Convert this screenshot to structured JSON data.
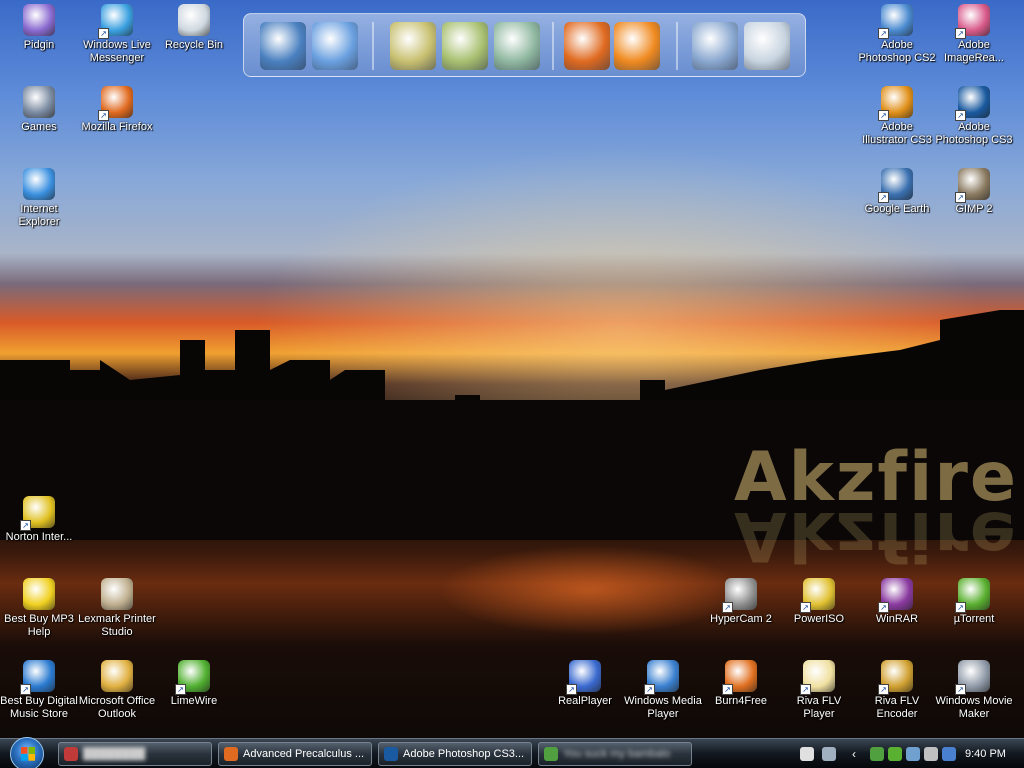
{
  "desktop": {
    "watermark": "Akzfire",
    "icons": [
      {
        "label": "Pidgin",
        "icon": "pidgin-icon",
        "color": "#8a6ad0"
      },
      {
        "label": "Windows Live Messenger",
        "icon": "messenger-icon",
        "color": "#3aa0e0"
      },
      {
        "label": "Recycle Bin",
        "icon": "recycle-bin-icon",
        "color": "#cfd8e0"
      },
      {
        "label": "Games",
        "icon": "games-icon",
        "color": "#7a8aa0"
      },
      {
        "label": "Mozilla Firefox",
        "icon": "firefox-icon",
        "color": "#e06a20"
      },
      {
        "label": "Internet Explorer",
        "icon": "internet-explorer-icon",
        "color": "#3a90e0"
      },
      {
        "label": "Adobe Photoshop CS2",
        "icon": "photoshop-cs2-icon",
        "color": "#4a8ad0"
      },
      {
        "label": "Adobe ImageRea...",
        "icon": "imageready-icon",
        "color": "#d85a8a"
      },
      {
        "label": "Adobe Illustrator CS3",
        "icon": "illustrator-icon",
        "color": "#e0901a"
      },
      {
        "label": "Adobe Photoshop CS3",
        "icon": "photoshop-cs3-icon",
        "color": "#1a5aa0"
      },
      {
        "label": "Google Earth",
        "icon": "google-earth-icon",
        "color": "#3a70b0"
      },
      {
        "label": "GIMP 2",
        "icon": "gimp-icon",
        "color": "#8a7a60"
      },
      {
        "label": "Norton Inter...",
        "icon": "norton-icon",
        "color": "#e0c020"
      },
      {
        "label": "Best Buy MP3 Help",
        "icon": "bestbuy-icon",
        "color": "#f0d020"
      },
      {
        "label": "Lexmark Printer Studio",
        "icon": "lexmark-icon",
        "color": "#c0b090"
      },
      {
        "label": "Best Buy Digital Music Store",
        "icon": "music-store-icon",
        "color": "#2a7ad0"
      },
      {
        "label": "Microsoft Office Outlook",
        "icon": "outlook-icon",
        "color": "#e0b040"
      },
      {
        "label": "LimeWire",
        "icon": "limewire-icon",
        "color": "#50b030"
      },
      {
        "label": "HyperCam 2",
        "icon": "hypercam-icon",
        "color": "#909090"
      },
      {
        "label": "PowerISO",
        "icon": "poweriso-icon",
        "color": "#e0c030"
      },
      {
        "label": "WinRAR",
        "icon": "winrar-icon",
        "color": "#8a3aa0"
      },
      {
        "label": "µTorrent",
        "icon": "utorrent-icon",
        "color": "#5ab030"
      },
      {
        "label": "RealPlayer",
        "icon": "realplayer-icon",
        "color": "#3a6ad0"
      },
      {
        "label": "Windows Media Player",
        "icon": "media-player-icon",
        "color": "#3a80d0"
      },
      {
        "label": "Burn4Free",
        "icon": "burn4free-icon",
        "color": "#e07020"
      },
      {
        "label": "Riva FLV Player",
        "icon": "riva-player-icon",
        "color": "#f0e0a0"
      },
      {
        "label": "Riva FLV Encoder",
        "icon": "riva-encoder-icon",
        "color": "#d0a030"
      },
      {
        "label": "Windows Movie Maker",
        "icon": "movie-maker-icon",
        "color": "#909aa8"
      }
    ]
  },
  "dock": {
    "items": [
      {
        "icon": "my-computer-icon",
        "color": "#4a80c0"
      },
      {
        "icon": "control-panel-icon",
        "color": "#6aa0e0"
      },
      {
        "icon": "documents-folder-icon",
        "color": "#c8c070"
      },
      {
        "icon": "pictures-folder-icon",
        "color": "#a8c070"
      },
      {
        "icon": "music-folder-icon",
        "color": "#90b8a0"
      },
      {
        "icon": "firefox-icon",
        "color": "#e06a20"
      },
      {
        "icon": "media-player-icon",
        "color": "#f08a20"
      },
      {
        "icon": "settings-gear-icon",
        "color": "#8aa8d0"
      },
      {
        "icon": "recycle-bin-icon",
        "color": "#c8d4e0"
      }
    ]
  },
  "taskbar": {
    "buttons": [
      {
        "label": "████████",
        "icon": "app-icon",
        "color": "#c03a3a",
        "blurred": true
      },
      {
        "label": "Advanced Precalculus ...",
        "icon": "firefox-icon",
        "color": "#e06a20",
        "blurred": false
      },
      {
        "label": "Adobe Photoshop CS3...",
        "icon": "photoshop-icon",
        "color": "#1a5aa0",
        "blurred": false
      },
      {
        "label": "You suck my bambalo",
        "icon": "messenger-icon",
        "color": "#50a040",
        "blurred": true
      }
    ],
    "tray_icons": [
      "help-icon",
      "network-icon",
      "chevron-left-icon",
      "messenger-tray-icon",
      "utorrent-tray-icon",
      "pidgin-tray-icon",
      "antivirus-tray-icon",
      "display-tray-icon"
    ],
    "clock": "9:40 PM"
  }
}
